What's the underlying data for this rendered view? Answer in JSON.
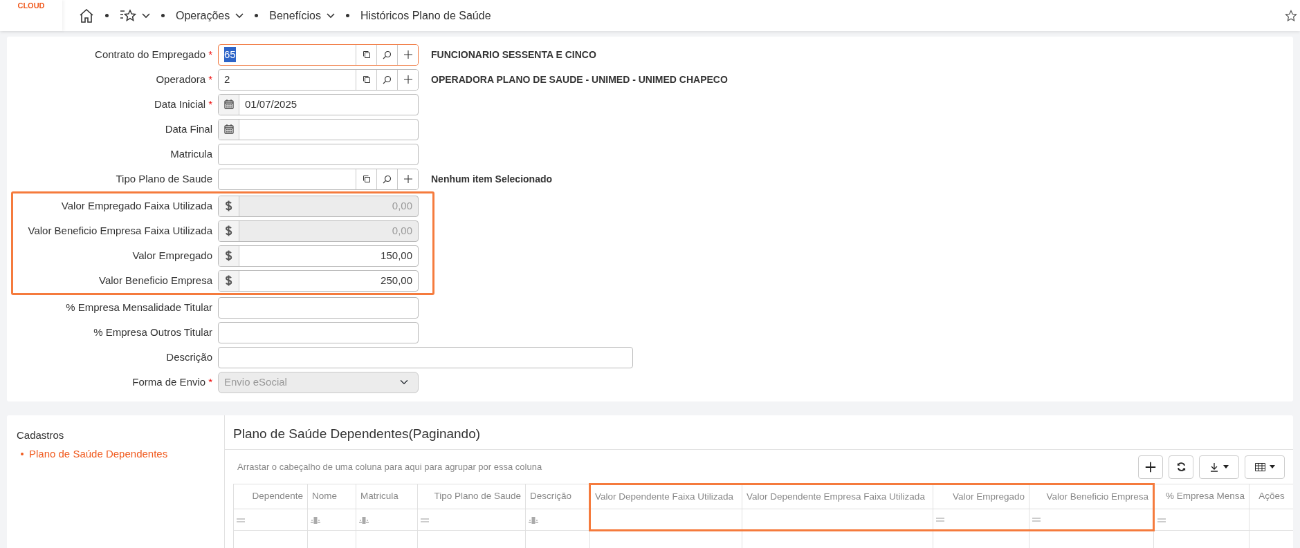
{
  "logo": {
    "text": "CLOUD"
  },
  "breadcrumb": [
    {
      "kind": "home"
    },
    {
      "kind": "favorites"
    },
    {
      "kind": "menu",
      "label": "Operações"
    },
    {
      "kind": "menu",
      "label": "Benefícios"
    },
    {
      "kind": "page",
      "label": "Históricos Plano de Saúde"
    }
  ],
  "form": {
    "fields": [
      {
        "label": "Contrato do Empregado",
        "required_mark": "*",
        "kind": "lookup",
        "value": "65",
        "focused": true,
        "info": "FUNCIONARIO SESSENTA E CINCO",
        "highlighted": false
      },
      {
        "label": "Operadora",
        "required_mark": "*",
        "kind": "lookup",
        "value": "2",
        "focused": false,
        "info": "OPERADORA PLANO DE SAUDE - UNIMED - UNIMED CHAPECO",
        "highlighted": false
      },
      {
        "label": "Data Inicial",
        "required_mark": "*",
        "kind": "date",
        "value": "01/07/2025",
        "highlighted": false
      },
      {
        "label": "Data Final",
        "kind": "date",
        "highlighted": false
      },
      {
        "label": "Matricula",
        "kind": "text",
        "highlighted": false
      },
      {
        "label": "Tipo Plano de Saude",
        "kind": "lookup",
        "focused": false,
        "info": "Nenhum item Selecionado",
        "highlighted": false
      },
      {
        "label": "Valor Empregado Faixa Utilizada",
        "kind": "money",
        "value": "0,00",
        "disabled": true,
        "highlighted": true
      },
      {
        "label": "Valor Beneficio Empresa Faixa Utilizada",
        "kind": "money",
        "value": "0,00",
        "disabled": true,
        "highlighted": true
      },
      {
        "label": "Valor Empregado",
        "kind": "money",
        "value": "150,00",
        "disabled": false,
        "highlighted": true
      },
      {
        "label": "Valor Beneficio Empresa",
        "kind": "money",
        "value": "250,00",
        "disabled": false,
        "highlighted": true
      },
      {
        "label": "% Empresa Mensalidade Titular",
        "kind": "text",
        "highlighted": false
      },
      {
        "label": "% Empresa Outros Titular",
        "kind": "text",
        "highlighted": false
      },
      {
        "label": "Descrição",
        "kind": "wide",
        "highlighted": false
      },
      {
        "label": "Forma de Envio",
        "required_mark": "*",
        "kind": "select",
        "value": "Envio eSocial",
        "disabled": true,
        "highlighted": false
      }
    ]
  },
  "sidebar": {
    "title": "Cadastros",
    "items": [
      {
        "label": "Plano de Saúde Dependentes",
        "selected": true
      }
    ]
  },
  "grid": {
    "title": "Plano de Saúde Dependentes(Paginando)",
    "group_hint": "Arrastar o cabeçalho de uma coluna para aqui para agrupar por essa coluna",
    "columns": [
      {
        "label": "Dependente",
        "kind": "number",
        "highlighted": false
      },
      {
        "label": "Nome",
        "kind": "text",
        "highlighted": false
      },
      {
        "label": "Matricula",
        "kind": "text",
        "highlighted": false
      },
      {
        "label": "Tipo Plano de Saude",
        "kind": "number",
        "highlighted": false
      },
      {
        "label": "Descrição",
        "kind": "text",
        "highlighted": false
      },
      {
        "label": "Valor Dependente Faixa Utilizada",
        "kind": "plain",
        "highlighted": true
      },
      {
        "label": "Valor Dependente Empresa Faixa Utilizada",
        "kind": "plain",
        "highlighted": true
      },
      {
        "label": "Valor Empregado",
        "kind": "number",
        "highlighted": true
      },
      {
        "label": "Valor Beneficio Empresa",
        "kind": "number",
        "highlighted": true
      },
      {
        "label": "% Empresa Mensa",
        "kind": "number",
        "highlighted": false
      },
      {
        "label": "Ações",
        "kind": "actions",
        "highlighted": false
      }
    ]
  }
}
